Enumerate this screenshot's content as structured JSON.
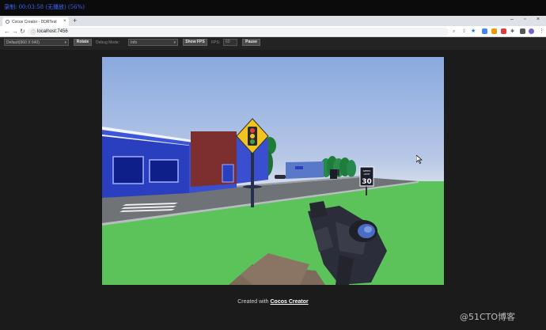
{
  "recording_bar": {
    "text": "录制: 00:03:58 (无播放) (56%)"
  },
  "browser": {
    "tab_title": "Cocos Creator - DDRTest",
    "tab_close": "×",
    "new_tab": "+",
    "window_controls": [
      "–",
      "▫",
      "×"
    ],
    "url": "localhost:7456",
    "nav_icons": [
      "back-icon",
      "forward-icon",
      "reload-icon"
    ]
  },
  "toolbar": {
    "resolution_select": "Default(960 X 640)",
    "rotate_label": "Rotate",
    "debug_mode_label": "Debug Mode:",
    "debug_mode_select": "Info",
    "show_fps_label": "Show FPS",
    "fps_label": "FPS:",
    "fps_value": "60",
    "pause_label": "Pause"
  },
  "game": {
    "speed_sign": {
      "line1": "SPEED",
      "line2": "LIMIT",
      "value": "30"
    },
    "colors": {
      "sky_top": "#8aa9e0",
      "sky_bottom": "#dfe6f2",
      "grass": "#5cc25a",
      "road": "#6f7378",
      "shop_blue": "#2a3ec0",
      "sign_yellow": "#f2c41f"
    }
  },
  "footer": {
    "prefix": "Created with",
    "link": "Cocos Creator"
  },
  "watermark": "@51CTO博客"
}
